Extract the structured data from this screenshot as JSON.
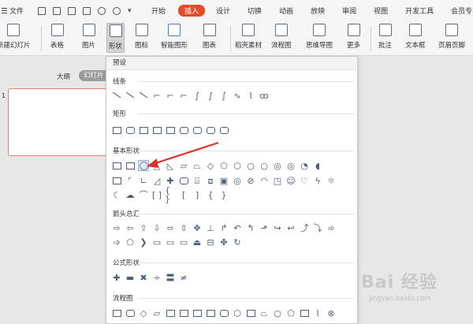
{
  "menubar": {
    "file_label": "文件",
    "quick_access_more": "▾",
    "tabs": [
      {
        "label": "开始"
      },
      {
        "label": "插入"
      },
      {
        "label": "设计"
      },
      {
        "label": "切换"
      },
      {
        "label": "动画"
      },
      {
        "label": "放映"
      },
      {
        "label": "审阅"
      },
      {
        "label": "视图"
      },
      {
        "label": "开发工具"
      },
      {
        "label": "会员专享"
      }
    ],
    "active_tab": "插入"
  },
  "ribbon": {
    "new_slide": "新建幻灯片",
    "table": "表格",
    "picture": "图片",
    "shapes": "形状",
    "icons": "图标",
    "smartart": "智能图形",
    "chart": "图表",
    "material": "稻壳素材",
    "flowchart": "流程图",
    "mindmap": "思维导图",
    "more": "更多",
    "annotation": "批注",
    "textbox": "文本框",
    "header_footer": "页眉页脚"
  },
  "leftpanel": {
    "outline_tab": "大纲",
    "slides_tab": "幻灯片",
    "slide_number": "1"
  },
  "dropdown": {
    "header": "预设",
    "sections": {
      "lines": "线条",
      "rectangles": "矩形",
      "basic": "基本形状",
      "arrows": "箭头总汇",
      "formula": "公式形状",
      "flowchart": "流程图"
    }
  },
  "watermark": {
    "brand": "Bai 经验",
    "url": "jingyan.baidu.com"
  },
  "colors": {
    "accent": "#e24c2a",
    "arrow": "#e0322b",
    "shape_stroke": "#4e5f77",
    "selected_bg": "#dfe9f7"
  }
}
